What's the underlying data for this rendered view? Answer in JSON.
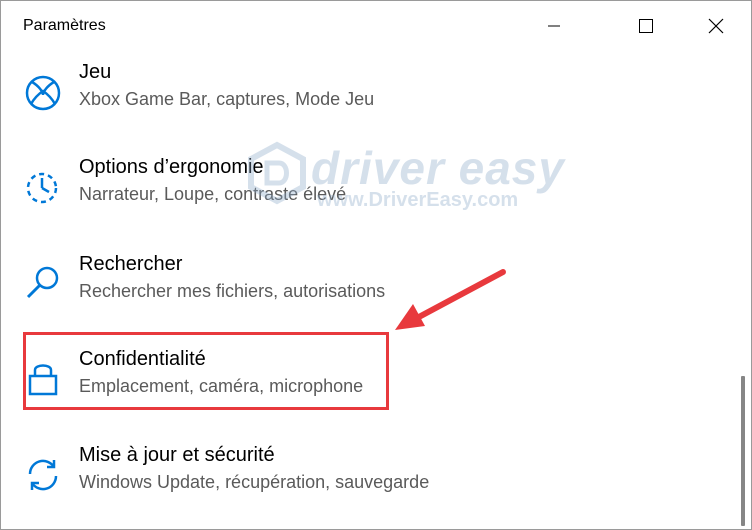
{
  "window": {
    "title": "Paramètres",
    "controls": {
      "minimize": "minimize-icon",
      "maximize": "maximize-icon",
      "close": "close-icon"
    }
  },
  "items": [
    {
      "label": "Jeu",
      "description": "Xbox Game Bar, captures, Mode Jeu",
      "icon": "xbox-icon"
    },
    {
      "label": "Options d’ergonomie",
      "description": "Narrateur, Loupe, contraste élevé",
      "icon": "ease-of-access-icon"
    },
    {
      "label": "Rechercher",
      "description": "Rechercher mes fichiers, autorisations",
      "icon": "search-icon"
    },
    {
      "label": "Confidentialité",
      "description": "Emplacement, caméra, microphone",
      "icon": "lock-icon"
    },
    {
      "label": "Mise à jour et sécurité",
      "description": "Windows Update, récupération, sauvegarde",
      "icon": "sync-icon"
    }
  ],
  "watermark": {
    "brand": "driver easy",
    "url": "www.DriverEasy.com"
  },
  "colors": {
    "accent": "#0078d7",
    "highlight": "#e8393d",
    "text": "#000000",
    "subtext": "#5a5a5a"
  }
}
